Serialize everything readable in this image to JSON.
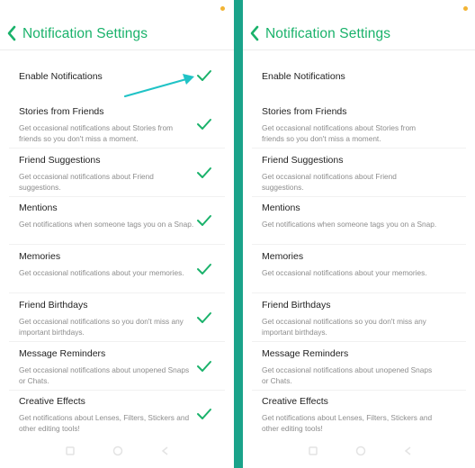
{
  "colors": {
    "accent": "#1ab26b",
    "divider": "#1aa38a",
    "arrow": "#20c3c6",
    "status_dot": "#f2b434",
    "nav_icon": "#e3e3e3"
  },
  "screens": [
    {
      "id": "left",
      "header": {
        "title": "Notification Settings",
        "back_icon": "chevron-left-icon"
      },
      "enable": {
        "label": "Enable Notifications",
        "checked": true
      },
      "annotation": {
        "icon": "arrow-icon",
        "points_to": "enable-notifications-check"
      },
      "items": [
        {
          "title": "Stories from Friends",
          "description": "Get occasional notifications about Stories from friends so you don't miss a moment.",
          "checked": true
        },
        {
          "title": "Friend Suggestions",
          "description": "Get occasional notifications about Friend suggestions.",
          "checked": true
        },
        {
          "title": "Mentions",
          "description": "Get notifications when someone tags you on a Snap.",
          "checked": true
        },
        {
          "title": "Memories",
          "description": "Get occasional notifications about your memories.",
          "checked": true
        },
        {
          "title": "Friend Birthdays",
          "description": "Get occasional notifications so you don't miss any important birthdays.",
          "checked": true
        },
        {
          "title": "Message Reminders",
          "description": "Get occasional notifications about unopened Snaps or Chats.",
          "checked": true
        },
        {
          "title": "Creative Effects",
          "description": "Get notifications about Lenses, Filters, Stickers and other editing tools!",
          "checked": true
        }
      ]
    },
    {
      "id": "right",
      "header": {
        "title": "Notification Settings",
        "back_icon": "chevron-left-icon"
      },
      "enable": {
        "label": "Enable Notifications",
        "checked": false
      },
      "items": [
        {
          "title": "Stories from Friends",
          "description": "Get occasional notifications about Stories from friends so you don't miss a moment.",
          "checked": false
        },
        {
          "title": "Friend Suggestions",
          "description": "Get occasional notifications about Friend suggestions.",
          "checked": false
        },
        {
          "title": "Mentions",
          "description": "Get notifications when someone tags you on a Snap.",
          "checked": false
        },
        {
          "title": "Memories",
          "description": "Get occasional notifications about your memories.",
          "checked": false
        },
        {
          "title": "Friend Birthdays",
          "description": "Get occasional notifications so you don't miss any important birthdays.",
          "checked": false
        },
        {
          "title": "Message Reminders",
          "description": "Get occasional notifications about unopened Snaps or Chats.",
          "checked": false
        },
        {
          "title": "Creative Effects",
          "description": "Get notifications about Lenses, Filters, Stickers and other editing tools!",
          "checked": false
        }
      ]
    }
  ],
  "navbar": {
    "icons": [
      "square-icon",
      "circle-home-icon",
      "triangle-back-icon"
    ]
  }
}
